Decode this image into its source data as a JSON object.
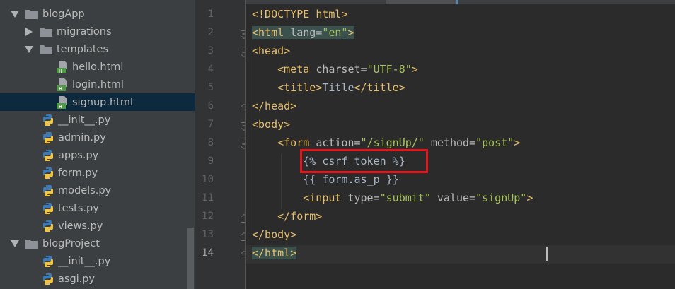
{
  "project_tree": {
    "items": [
      {
        "label": "blogApp",
        "kind": "folder",
        "expanded": true,
        "depth": 0
      },
      {
        "label": "migrations",
        "kind": "folder",
        "expanded": false,
        "depth": 1
      },
      {
        "label": "templates",
        "kind": "folder",
        "expanded": true,
        "depth": 1
      },
      {
        "label": "hello.html",
        "kind": "html",
        "depth": 2
      },
      {
        "label": "login.html",
        "kind": "html",
        "depth": 2
      },
      {
        "label": "signup.html",
        "kind": "html",
        "depth": 2,
        "selected": true
      },
      {
        "label": "__init__.py",
        "kind": "py",
        "depth": 1
      },
      {
        "label": "admin.py",
        "kind": "py",
        "depth": 1
      },
      {
        "label": "apps.py",
        "kind": "py",
        "depth": 1
      },
      {
        "label": "form.py",
        "kind": "py",
        "depth": 1
      },
      {
        "label": "models.py",
        "kind": "py",
        "depth": 1
      },
      {
        "label": "tests.py",
        "kind": "py",
        "depth": 1
      },
      {
        "label": "views.py",
        "kind": "py",
        "depth": 1
      },
      {
        "label": "blogProject",
        "kind": "folder",
        "expanded": true,
        "depth": 0
      },
      {
        "label": "__init__.py",
        "kind": "py",
        "depth": 1
      },
      {
        "label": "asgi.py",
        "kind": "py",
        "depth": 1
      }
    ]
  },
  "editor": {
    "current_line": 14,
    "highlighted_text": "{% csrf_token %}",
    "lines": [
      {
        "number": "1",
        "text": "<!DOCTYPE html>"
      },
      {
        "number": "2",
        "text": "<html lang=\"en\">"
      },
      {
        "number": "3",
        "text": "<head>"
      },
      {
        "number": "4",
        "text": "    <meta charset=\"UTF-8\">"
      },
      {
        "number": "5",
        "text": "    <title>Title</title>"
      },
      {
        "number": "6",
        "text": "</head>"
      },
      {
        "number": "7",
        "text": "<body>"
      },
      {
        "number": "8",
        "text": "    <form action=\"/signUp/\" method=\"post\">"
      },
      {
        "number": "9",
        "text": "        {% csrf_token %}"
      },
      {
        "number": "10",
        "text": "        {{ form.as_p }}"
      },
      {
        "number": "11",
        "text": "        <input type=\"submit\" value=\"signUp\">"
      },
      {
        "number": "12",
        "text": "    </form>"
      },
      {
        "number": "13",
        "text": "</body>"
      },
      {
        "number": "14",
        "text": "</html>"
      }
    ]
  },
  "colors": {
    "tree_bg": "#3c3f41",
    "selection": "#0d293e",
    "editor_bg": "#2b2b2b",
    "tag": "#e8bf6a",
    "attribute_value": "#a5c25c",
    "highlight_box": "#e8141c"
  },
  "icons": {
    "folder": "folder-icon",
    "html_file": "html-file-icon",
    "python_file": "python-file-icon",
    "expand": "chevron-down-icon",
    "collapse": "chevron-right-icon",
    "fold": "fold-marker-icon"
  }
}
